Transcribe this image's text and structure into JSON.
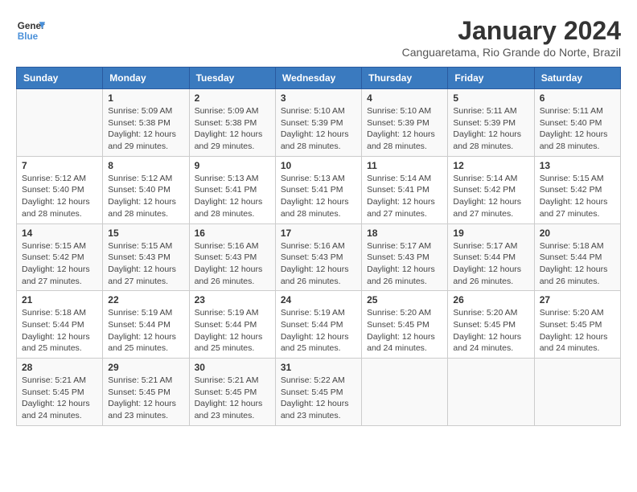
{
  "header": {
    "logo_line1": "General",
    "logo_line2": "Blue",
    "month": "January 2024",
    "location": "Canguaretama, Rio Grande do Norte, Brazil"
  },
  "days_of_week": [
    "Sunday",
    "Monday",
    "Tuesday",
    "Wednesday",
    "Thursday",
    "Friday",
    "Saturday"
  ],
  "weeks": [
    [
      {
        "day": "",
        "info": ""
      },
      {
        "day": "1",
        "info": "Sunrise: 5:09 AM\nSunset: 5:38 PM\nDaylight: 12 hours\nand 29 minutes."
      },
      {
        "day": "2",
        "info": "Sunrise: 5:09 AM\nSunset: 5:38 PM\nDaylight: 12 hours\nand 29 minutes."
      },
      {
        "day": "3",
        "info": "Sunrise: 5:10 AM\nSunset: 5:39 PM\nDaylight: 12 hours\nand 28 minutes."
      },
      {
        "day": "4",
        "info": "Sunrise: 5:10 AM\nSunset: 5:39 PM\nDaylight: 12 hours\nand 28 minutes."
      },
      {
        "day": "5",
        "info": "Sunrise: 5:11 AM\nSunset: 5:39 PM\nDaylight: 12 hours\nand 28 minutes."
      },
      {
        "day": "6",
        "info": "Sunrise: 5:11 AM\nSunset: 5:40 PM\nDaylight: 12 hours\nand 28 minutes."
      }
    ],
    [
      {
        "day": "7",
        "info": "Sunrise: 5:12 AM\nSunset: 5:40 PM\nDaylight: 12 hours\nand 28 minutes."
      },
      {
        "day": "8",
        "info": "Sunrise: 5:12 AM\nSunset: 5:40 PM\nDaylight: 12 hours\nand 28 minutes."
      },
      {
        "day": "9",
        "info": "Sunrise: 5:13 AM\nSunset: 5:41 PM\nDaylight: 12 hours\nand 28 minutes."
      },
      {
        "day": "10",
        "info": "Sunrise: 5:13 AM\nSunset: 5:41 PM\nDaylight: 12 hours\nand 28 minutes."
      },
      {
        "day": "11",
        "info": "Sunrise: 5:14 AM\nSunset: 5:41 PM\nDaylight: 12 hours\nand 27 minutes."
      },
      {
        "day": "12",
        "info": "Sunrise: 5:14 AM\nSunset: 5:42 PM\nDaylight: 12 hours\nand 27 minutes."
      },
      {
        "day": "13",
        "info": "Sunrise: 5:15 AM\nSunset: 5:42 PM\nDaylight: 12 hours\nand 27 minutes."
      }
    ],
    [
      {
        "day": "14",
        "info": "Sunrise: 5:15 AM\nSunset: 5:42 PM\nDaylight: 12 hours\nand 27 minutes."
      },
      {
        "day": "15",
        "info": "Sunrise: 5:15 AM\nSunset: 5:43 PM\nDaylight: 12 hours\nand 27 minutes."
      },
      {
        "day": "16",
        "info": "Sunrise: 5:16 AM\nSunset: 5:43 PM\nDaylight: 12 hours\nand 26 minutes."
      },
      {
        "day": "17",
        "info": "Sunrise: 5:16 AM\nSunset: 5:43 PM\nDaylight: 12 hours\nand 26 minutes."
      },
      {
        "day": "18",
        "info": "Sunrise: 5:17 AM\nSunset: 5:43 PM\nDaylight: 12 hours\nand 26 minutes."
      },
      {
        "day": "19",
        "info": "Sunrise: 5:17 AM\nSunset: 5:44 PM\nDaylight: 12 hours\nand 26 minutes."
      },
      {
        "day": "20",
        "info": "Sunrise: 5:18 AM\nSunset: 5:44 PM\nDaylight: 12 hours\nand 26 minutes."
      }
    ],
    [
      {
        "day": "21",
        "info": "Sunrise: 5:18 AM\nSunset: 5:44 PM\nDaylight: 12 hours\nand 25 minutes."
      },
      {
        "day": "22",
        "info": "Sunrise: 5:19 AM\nSunset: 5:44 PM\nDaylight: 12 hours\nand 25 minutes."
      },
      {
        "day": "23",
        "info": "Sunrise: 5:19 AM\nSunset: 5:44 PM\nDaylight: 12 hours\nand 25 minutes."
      },
      {
        "day": "24",
        "info": "Sunrise: 5:19 AM\nSunset: 5:44 PM\nDaylight: 12 hours\nand 25 minutes."
      },
      {
        "day": "25",
        "info": "Sunrise: 5:20 AM\nSunset: 5:45 PM\nDaylight: 12 hours\nand 24 minutes."
      },
      {
        "day": "26",
        "info": "Sunrise: 5:20 AM\nSunset: 5:45 PM\nDaylight: 12 hours\nand 24 minutes."
      },
      {
        "day": "27",
        "info": "Sunrise: 5:20 AM\nSunset: 5:45 PM\nDaylight: 12 hours\nand 24 minutes."
      }
    ],
    [
      {
        "day": "28",
        "info": "Sunrise: 5:21 AM\nSunset: 5:45 PM\nDaylight: 12 hours\nand 24 minutes."
      },
      {
        "day": "29",
        "info": "Sunrise: 5:21 AM\nSunset: 5:45 PM\nDaylight: 12 hours\nand 23 minutes."
      },
      {
        "day": "30",
        "info": "Sunrise: 5:21 AM\nSunset: 5:45 PM\nDaylight: 12 hours\nand 23 minutes."
      },
      {
        "day": "31",
        "info": "Sunrise: 5:22 AM\nSunset: 5:45 PM\nDaylight: 12 hours\nand 23 minutes."
      },
      {
        "day": "",
        "info": ""
      },
      {
        "day": "",
        "info": ""
      },
      {
        "day": "",
        "info": ""
      }
    ]
  ]
}
